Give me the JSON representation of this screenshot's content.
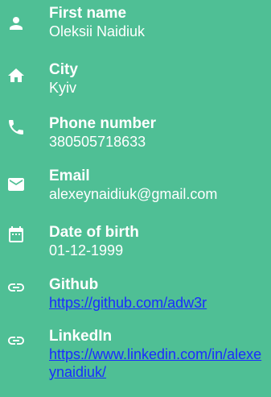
{
  "fields": [
    {
      "icon": "person-icon",
      "label": "First name",
      "value": "Oleksii Naidiuk"
    },
    {
      "icon": "home-icon",
      "label": "City",
      "value": "Kyiv"
    },
    {
      "icon": "phone-icon",
      "label": "Phone number",
      "value": "380505718633"
    },
    {
      "icon": "email-icon",
      "label": "Email",
      "value": "alexeynaidiuk@gmail.com"
    },
    {
      "icon": "calendar-icon",
      "label": "Date of birth",
      "value": "01-12-1999"
    },
    {
      "icon": "link-icon",
      "label": "Github",
      "value": "https://github.com/adw3r"
    },
    {
      "icon": "link-icon",
      "label": "LinkedIn",
      "value": "https://www.linkedin.com/in/alexeynaidiuk/"
    }
  ],
  "colors": {
    "background": "#4fbf95",
    "text": "#ffffff",
    "link": "#1a2cff"
  }
}
